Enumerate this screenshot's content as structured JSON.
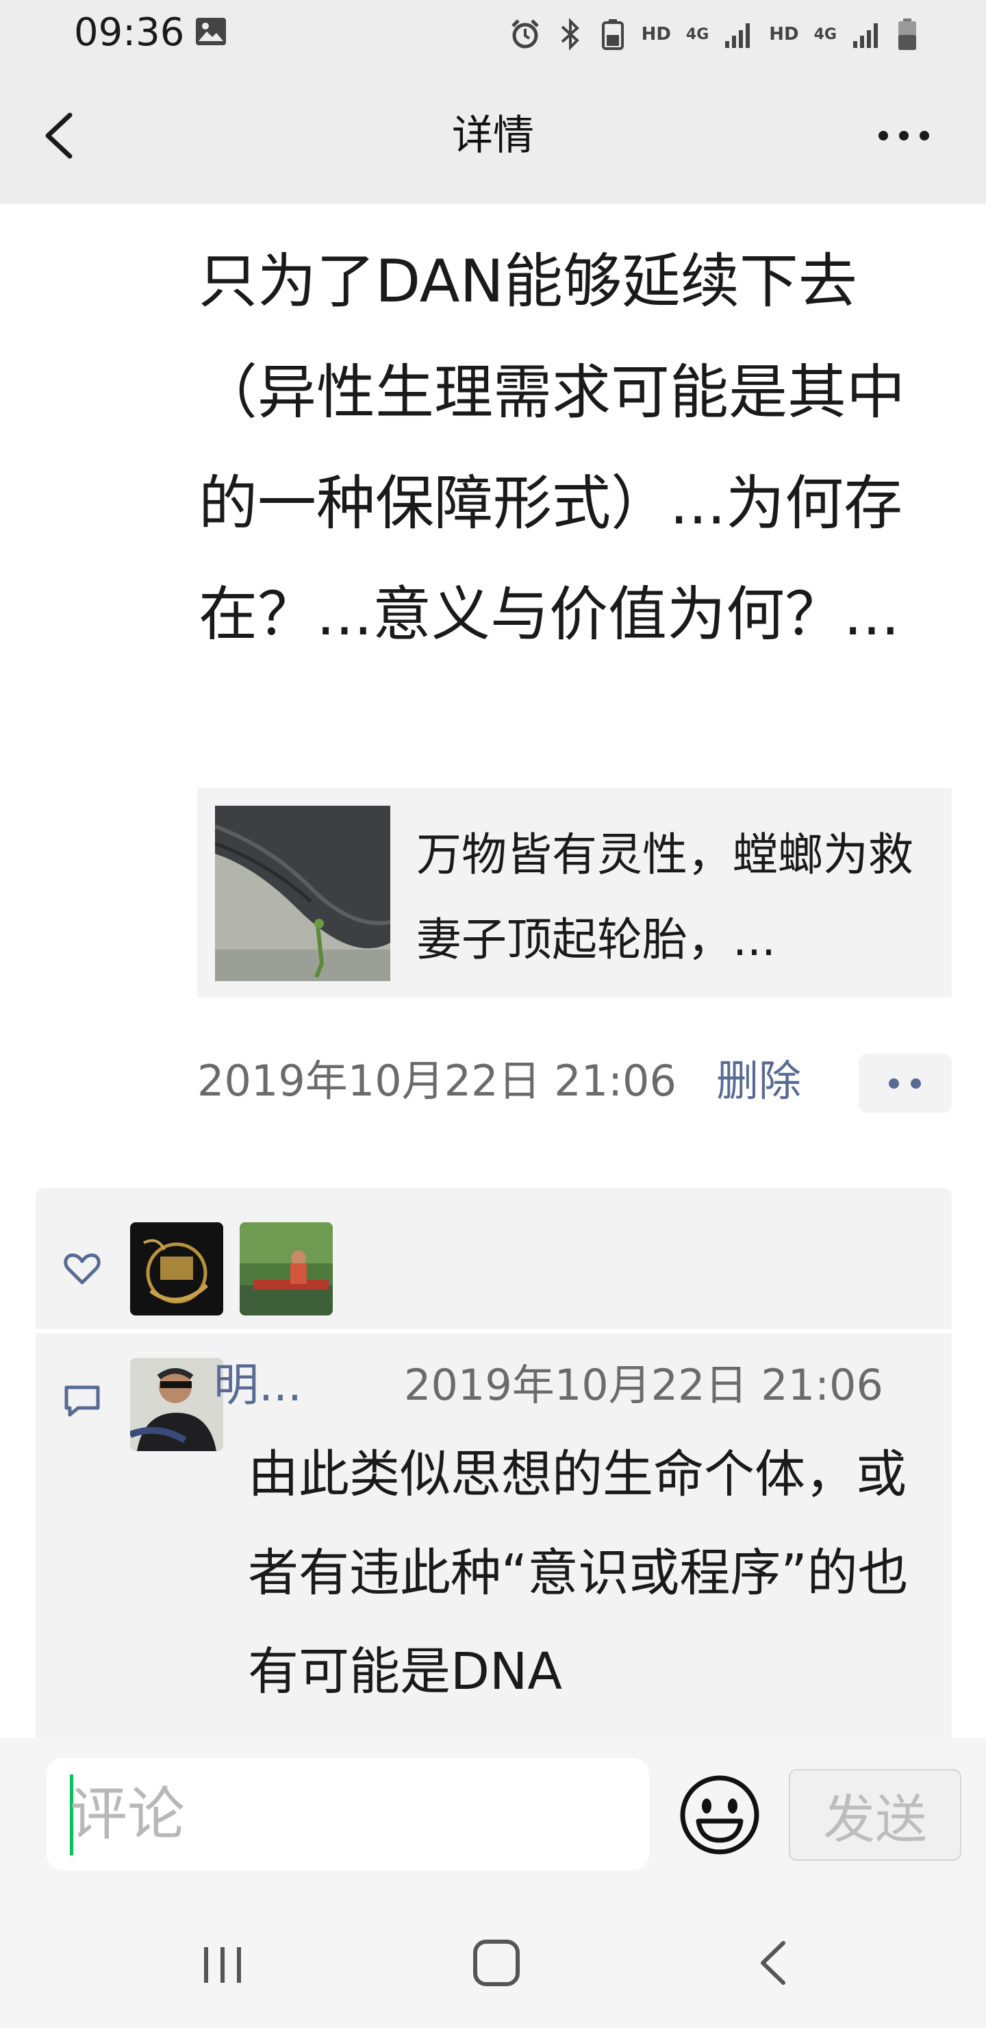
{
  "status_bar": {
    "time": "09:36",
    "hd1": "HD",
    "net1": "4G",
    "hd2": "HD",
    "net2": "4G"
  },
  "nav": {
    "title": "详情"
  },
  "post": {
    "text": "只为了DAN能够延续下去（异性生理需求可能是其中的一种保障形式）...为何存在？...意义与价值为何？...",
    "link_title": "万物皆有灵性，螳螂为救妻子顶起轮胎，...",
    "time": "2019年10月22日 21:06",
    "delete_label": "删除"
  },
  "comment": {
    "name": "明...",
    "time": "2019年10月22日 21:06",
    "text": "由此类似思想的生命个体，或者有违此种“意识或程序”的也有可能是DNA"
  },
  "input": {
    "placeholder": "评论",
    "send_label": "发送"
  },
  "colors": {
    "link_blue": "#576b95",
    "accent_green": "#07c160",
    "panel_gray": "#f3f3f3"
  }
}
